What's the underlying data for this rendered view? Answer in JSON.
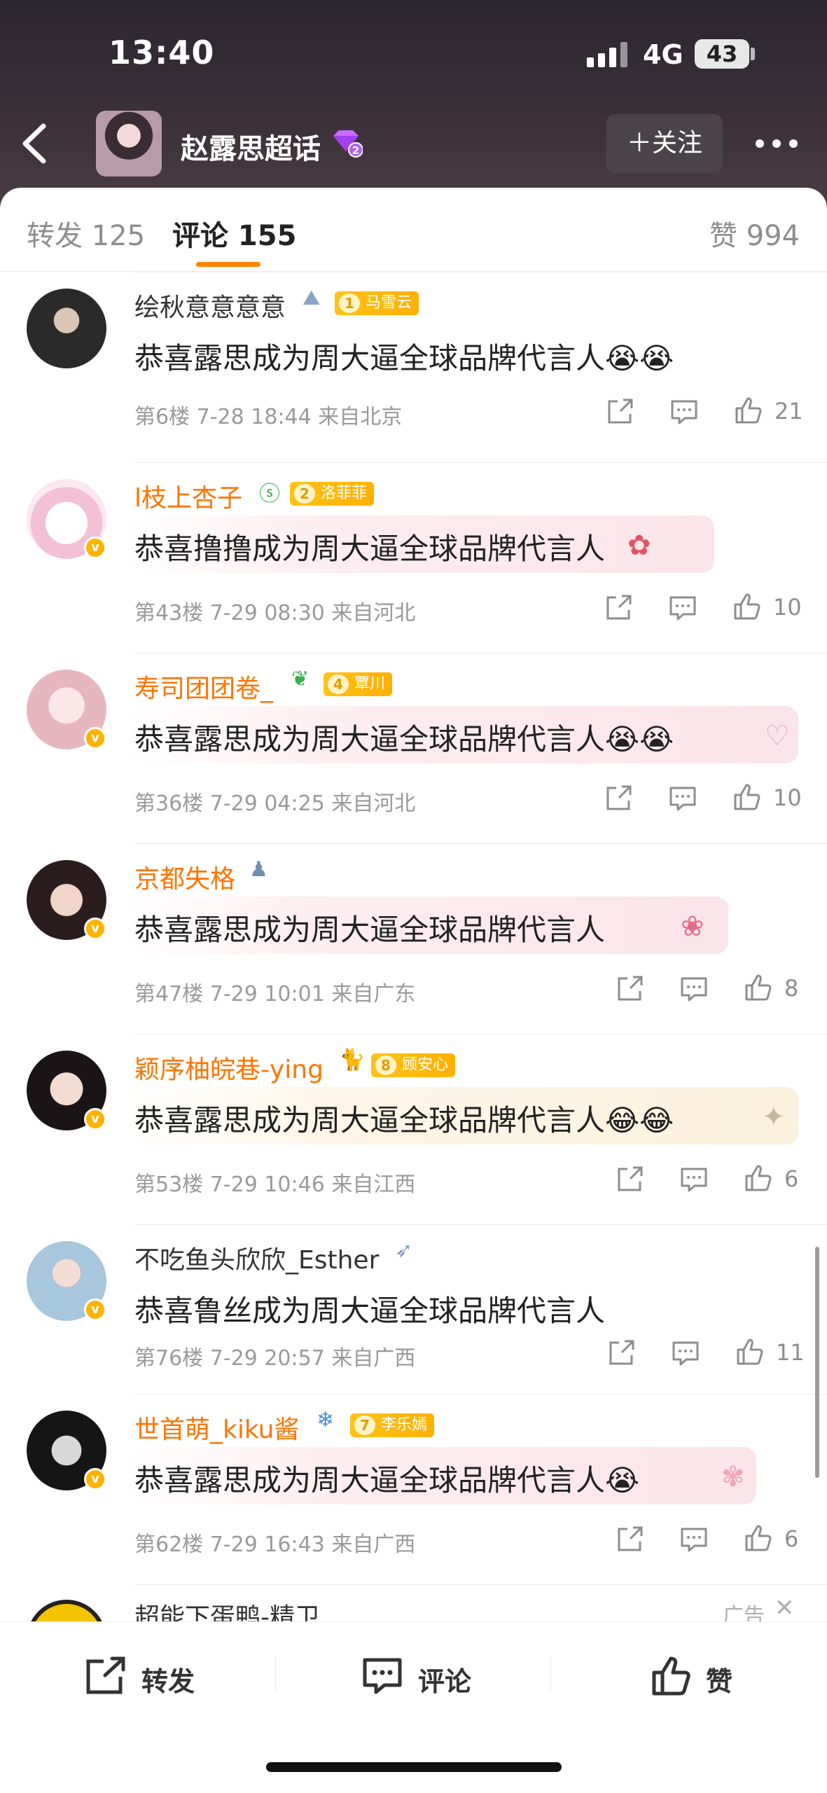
{
  "status": {
    "time": "13:40",
    "network": "4G",
    "battery": "43"
  },
  "header": {
    "topic_title": "赵露思超话",
    "follow_label": "＋关注"
  },
  "tabs": [
    {
      "label": "转发 125"
    },
    {
      "label": "评论 155"
    },
    {
      "label": "赞 994"
    }
  ],
  "comments": [
    {
      "user": "绘秋意意意意",
      "badge_level": "1",
      "badge_name": "马雪云",
      "text": "恭喜露思成为周大逼全球品牌代言人",
      "emojis": "😭😭",
      "meta": "第6楼 7-28 18:44 来自北京",
      "likes": "21"
    },
    {
      "user": "l枝上杏子",
      "badge_level": "2",
      "badge_name": "洛菲菲",
      "text": "恭喜撸撸成为周大逼全球品牌代言人",
      "emojis": "",
      "meta": "第43楼 7-29 08:30 来自河北",
      "likes": "10"
    },
    {
      "user": "寿司团团卷_",
      "badge_level": "4",
      "badge_name": "覃川",
      "text": "恭喜露思成为周大逼全球品牌代言人",
      "emojis": "😭😭",
      "meta": "第36楼 7-29 04:25 来自河北",
      "likes": "10"
    },
    {
      "user": "京都失格",
      "badge_level": "",
      "badge_name": "",
      "text": "恭喜露思成为周大逼全球品牌代言人",
      "emojis": "",
      "meta": "第47楼 7-29 10:01 来自广东",
      "likes": "8"
    },
    {
      "user": "颖序柚皖巷-ying",
      "badge_level": "8",
      "badge_name": "顾安心",
      "text": "恭喜露思成为周大逼全球品牌代言人",
      "emojis": "😂😂",
      "meta": "第53楼 7-29 10:46 来自江西",
      "likes": "6"
    },
    {
      "user": "不吃鱼头欣欣_Esther",
      "badge_level": "",
      "badge_name": "",
      "text": "恭喜鲁丝成为周大逼全球品牌代言人",
      "emojis": "",
      "meta": "第76楼 7-29 20:57 来自广西",
      "likes": "11"
    },
    {
      "user": "世首萌_kiku酱",
      "badge_level": "7",
      "badge_name": "李乐嫣",
      "text": "恭喜露思成为周大逼全球品牌代言人",
      "emojis": "😭",
      "meta": "第62楼 7-29 16:43 来自广西",
      "likes": "6"
    }
  ],
  "ad": {
    "user": "超能下蛋鸭-精卫",
    "label": "广告"
  },
  "bottom_bar": {
    "repost": "转发",
    "comment": "评论",
    "like": "赞"
  }
}
